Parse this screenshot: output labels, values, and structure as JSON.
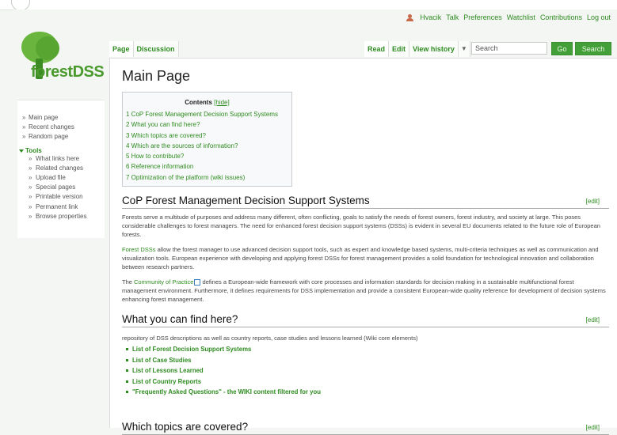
{
  "personal": {
    "user": "Hvacik",
    "links": [
      "Talk",
      "Preferences",
      "Watchlist",
      "Contributions",
      "Log out"
    ]
  },
  "logo": {
    "text": "forestDSS"
  },
  "tabs": {
    "left": [
      "Page",
      "Discussion"
    ],
    "right": [
      "Read",
      "Edit",
      "View history"
    ],
    "dropdown": "▼"
  },
  "search": {
    "placeholder": "Search",
    "go": "Go",
    "search": "Search"
  },
  "sidebar": {
    "items": [
      "Main page",
      "Recent changes",
      "Random page"
    ],
    "tools_label": "Tools",
    "tools": [
      "What links here",
      "Related changes",
      "Upload file",
      "Special pages",
      "Printable version",
      "Permanent link",
      "Browse properties"
    ]
  },
  "page_title": "Main Page",
  "toc": {
    "title": "Contents",
    "hide": "[hide]",
    "items": [
      "1 CoP Forest Management Decision Support Systems",
      "2 What you can find here?",
      "3 Which topics are covered?",
      "4 Which are the sources of information?",
      "5 How to contribute?",
      "6 Reference information",
      "7 Optimization of the platform (wiki issues)"
    ]
  },
  "edit_label": "[edit]",
  "section1": {
    "heading": "CoP Forest Management Decision Support Systems",
    "p1": "Forests serve a multitude of purposes and address many different, often conflicting, goals to satisfy the needs of forest owners, forest industry, and society at large. This poses considerable challenges to forest managers. The need for enhanced forest decision support systems (DSSs) is evident in several EU documents related to the future role of European forests.",
    "p2_link": "Forest DSSs",
    "p2": " allow the forest manager to use advanced decision support tools, such as expert and knowledge based systems, multi-criteria techniques as well as communication and visualization tools. European experience with developing and applying forest DSSs for forest management provides a solid foundation for technological innovation and collaboration between research partners.",
    "p3_pre": "The ",
    "p3_link": "Community of Practice",
    "p3": " defines a European-wide framework with core processes and information standards for decision making in a sustainable multifunctional forest management environment. Furthermore, it defines requirements for DSS implementation and provide a consistent European-wide quality reference for development of decision systems enhancing forest management."
  },
  "section2": {
    "heading": "What you can find here?",
    "intro": "repository of DSS descriptions as well as country reports, case studies and lessons learned (Wiki core elements)",
    "bullets": [
      "List of Forest Decision Support Systems",
      "List of Case Studies",
      "List of Lessons Learned",
      "List of Country Reports",
      "\"Frequently Asked Questions\" - the WIKI content filtered for you"
    ]
  },
  "section3": {
    "heading": "Which topics are covered?"
  }
}
